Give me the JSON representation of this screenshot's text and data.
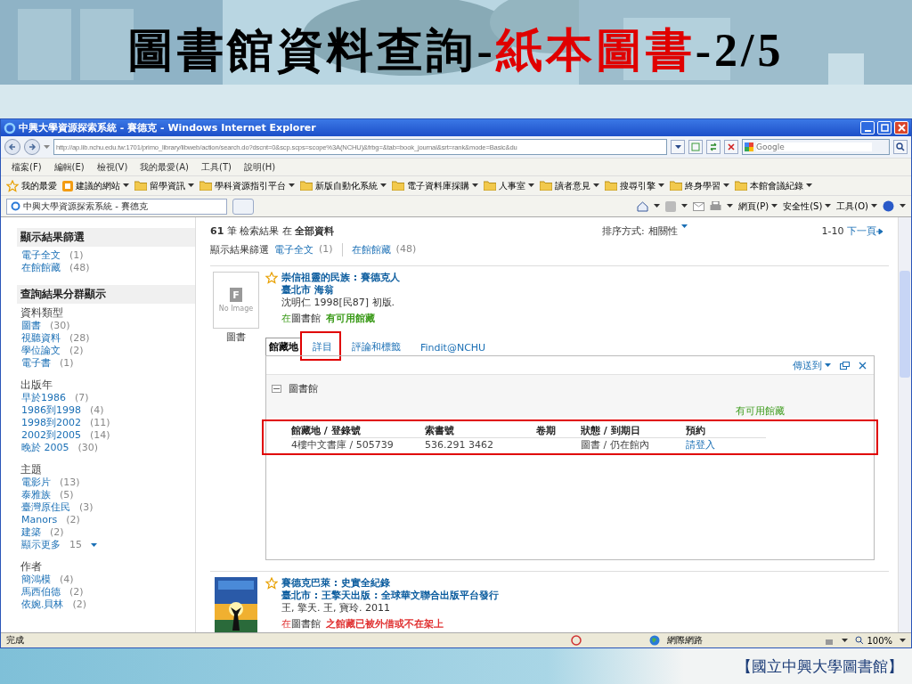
{
  "slide": {
    "title": [
      {
        "text": "圖書館資料查詢-",
        "color": "#000000"
      },
      {
        "text": "紙本圖書",
        "color": "#e00000"
      },
      {
        "text": "-2/5",
        "color": "#000000"
      }
    ],
    "footer": "【國立中興大學圖書館】"
  },
  "window": {
    "title": "中興大學資源探索系統 - 賽德克 - Windows Internet Explorer",
    "address": "http://ap.lib.nchu.edu.tw:1701/primo_library/libweb/action/search.do?dscnt=0&scp.scps=scope%3A(NCHU)&frbg=&tab=book_journal&srt=rank&mode=Basic&du",
    "search": {
      "placeholder": "Google"
    }
  },
  "menu": [
    "檔案(F)",
    "編輯(E)",
    "檢視(V)",
    "我的最愛(A)",
    "工具(T)",
    "說明(H)"
  ],
  "favorites": {
    "label": "我的最愛",
    "items": [
      {
        "label": "建議的網站",
        "kind": "site"
      },
      {
        "label": "留學資訊",
        "kind": "folder"
      },
      {
        "label": "學科資源指引平台",
        "kind": "folder"
      },
      {
        "label": "新版自動化系統",
        "kind": "folder"
      },
      {
        "label": "電子資料庫採購",
        "kind": "folder"
      },
      {
        "label": "人事室",
        "kind": "folder"
      },
      {
        "label": "讀者意見",
        "kind": "folder"
      },
      {
        "label": "搜尋引擎",
        "kind": "folder"
      },
      {
        "label": "終身學習",
        "kind": "folder"
      },
      {
        "label": "本館會議紀錄",
        "kind": "folder"
      }
    ]
  },
  "tab": {
    "label": "中興大學資源探索系統 - 賽德克"
  },
  "tools": [
    "網頁(P)",
    "安全性(S)",
    "工具(O)"
  ],
  "sidebar": {
    "filter": {
      "title": "顯示結果篩選",
      "items": [
        {
          "label": "電子全文",
          "count": "(1)"
        },
        {
          "label": "在館館藏",
          "count": "(48)"
        }
      ]
    },
    "groups_title": "查詢結果分群顯示",
    "groups": [
      {
        "title": "資料類型",
        "items": [
          {
            "label": "圖書",
            "count": "(30)"
          },
          {
            "label": "視聽資料",
            "count": "(28)"
          },
          {
            "label": "學位論文",
            "count": "(2)"
          },
          {
            "label": "電子書",
            "count": "(1)"
          }
        ]
      },
      {
        "title": "出版年",
        "items": [
          {
            "label": "早於1986",
            "count": "(7)"
          },
          {
            "label": "1986到1998",
            "count": "(4)"
          },
          {
            "label": "1998到2002",
            "count": "(11)"
          },
          {
            "label": "2002到2005",
            "count": "(14)"
          },
          {
            "label": "晚於 2005",
            "count": "(30)"
          }
        ]
      },
      {
        "title": "主題",
        "items": [
          {
            "label": "電影片",
            "count": "(13)"
          },
          {
            "label": "泰雅族",
            "count": "(5)"
          },
          {
            "label": "臺灣原住民",
            "count": "(3)"
          },
          {
            "label": "Manors",
            "count": "(2)"
          },
          {
            "label": "建築",
            "count": "(2)"
          }
        ],
        "more": {
          "label": "顯示更多",
          "count": "15"
        }
      },
      {
        "title": "作者",
        "items": [
          {
            "label": "簡鴻模",
            "count": "(4)"
          },
          {
            "label": "馬西伯德",
            "count": "(2)"
          },
          {
            "label": "依婉.貝林",
            "count": "(2)"
          }
        ]
      }
    ]
  },
  "results_header": {
    "summary": "**61** 筆 檢索結果 在 **全部資料**",
    "sort_label": "排序方式:",
    "sort_value": "相關性",
    "range": "1-10",
    "next": "下一頁",
    "filter_label": "顯示結果篩選",
    "filters": [
      {
        "label": "電子全文",
        "count": "(1)"
      },
      {
        "label": "在館館藏",
        "count": "(48)"
      }
    ]
  },
  "results": [
    {
      "thumbnail": {
        "kind": "placeholder",
        "mark": "F",
        "caption": "No Image"
      },
      "type": "圖書",
      "title": "崇信祖靈的民族 : 賽德克人",
      "publisher": "臺北市 海翁",
      "details": "沈明仁 1998[民87] 初版.",
      "place_prefix": "在",
      "place": "圖書館",
      "status": "有可用館藏",
      "available": true,
      "tabs": [
        {
          "label": "館藏地",
          "selected": true,
          "highlighted": false
        },
        {
          "label": "詳目",
          "selected": false,
          "highlighted": true
        },
        {
          "label": "評論和標籤",
          "selected": false,
          "highlighted": false
        },
        {
          "label": "Findit@NCHU",
          "selected": false,
          "highlighted": false
        }
      ],
      "panel": {
        "send_to": "傳送到",
        "library": "圖書館",
        "expanded": true,
        "availability": "有可用館藏",
        "highlighted": true,
        "columns": [
          "館藏地 / 登錄號",
          "索書號",
          "卷期",
          "狀態 / 到期日",
          "預約"
        ],
        "rows": [
          [
            "4樓中文書庫 / 505739",
            "536.291 3462",
            "",
            "圖書 / 仍在館內",
            "請登入"
          ]
        ]
      }
    },
    {
      "title": "賽德克巴萊 : 史實全紀錄",
      "publisher": "臺北市 : 王擎天出版 : 全球華文聯合出版平台發行",
      "details": "王, 擎天. 王, 寶玲. 2011",
      "place_prefix": "在",
      "place": "圖書館",
      "status": "之館藏已被外借或不在架上",
      "available": false
    }
  ],
  "status_bar": {
    "text": "完成",
    "zone": "網際網路",
    "zoom": "100%"
  }
}
